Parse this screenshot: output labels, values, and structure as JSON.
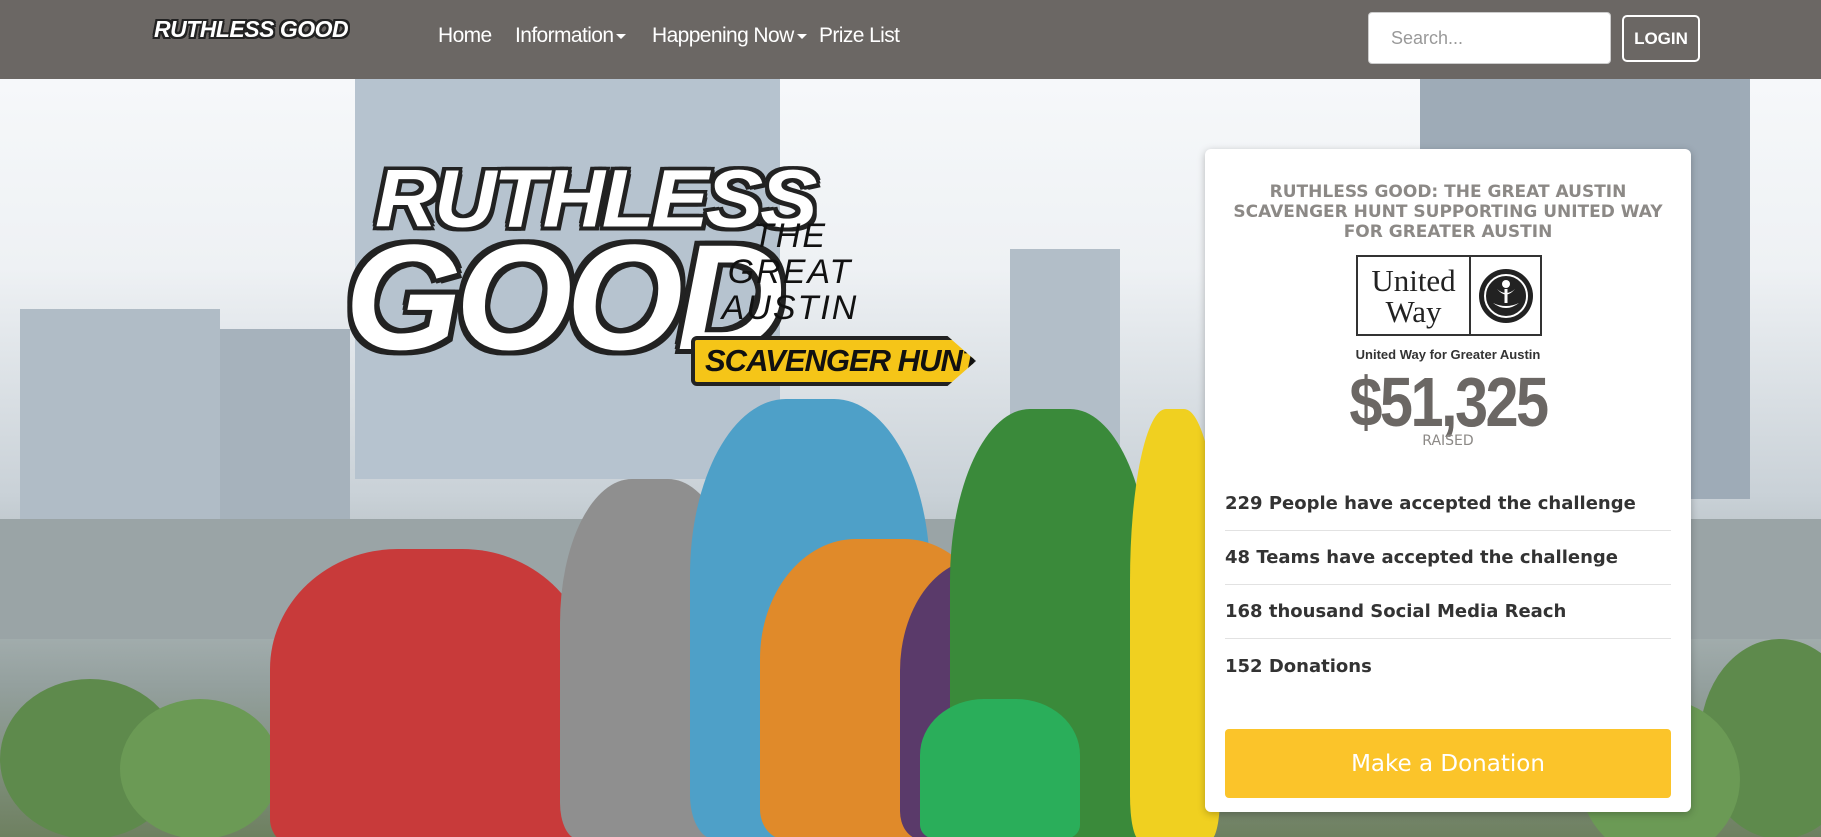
{
  "navbar": {
    "brand": "RUTHLESS GOOD",
    "items": [
      {
        "label": "Home",
        "dropdown": false
      },
      {
        "label": "Information",
        "dropdown": true
      },
      {
        "label": "Happening Now",
        "dropdown": true
      },
      {
        "label": "Prize List",
        "dropdown": false
      }
    ],
    "search_placeholder": "Search...",
    "login_label": "LOGIN"
  },
  "hero_logo": {
    "line1": "RUTHLESS",
    "line2": "GOOD",
    "tagline_lines": [
      "THE",
      "GREAT",
      "AUSTIN"
    ],
    "banner": "SCAVENGER HUNT"
  },
  "donation_card": {
    "title": "RUTHLESS GOOD: THE GREAT AUSTIN SCAVENGER HUNT SUPPORTING UNITED WAY FOR GREATER AUSTIN",
    "beneficiary_logo": {
      "line1": "United",
      "line2": "Way"
    },
    "beneficiary_caption": "United Way for Greater Austin",
    "amount_raised": "$51,325",
    "raised_label": "RAISED",
    "stats": [
      "229 People have accepted the challenge",
      "48 Teams have accepted the challenge",
      "168 thousand Social Media Reach",
      "152 Donations"
    ],
    "donate_label": "Make a Donation"
  },
  "colors": {
    "navbar_bg": "#6b6764",
    "accent_yellow": "#fbc42a",
    "card_title_gray": "#8c8986"
  }
}
